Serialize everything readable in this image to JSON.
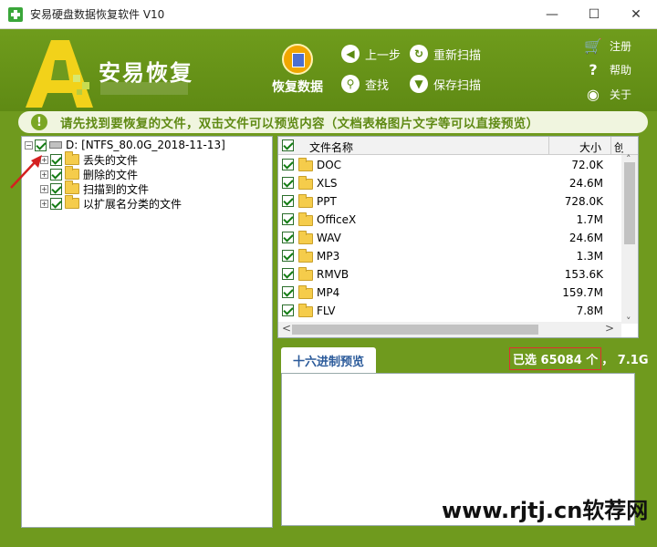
{
  "window": {
    "title": "安易硬盘数据恢复软件 V10",
    "minimize": "—",
    "maximize": "☐",
    "close": "✕"
  },
  "header": {
    "app_name": "安易恢复",
    "recover_label": "恢复数据",
    "toolbar": [
      {
        "icon": "arrow-left-icon",
        "glyph": "◀",
        "label": "上一步"
      },
      {
        "icon": "refresh-icon",
        "glyph": "↻",
        "label": "重新扫描"
      },
      {
        "icon": "search-icon",
        "glyph": "⚲",
        "label": "查找"
      },
      {
        "icon": "save-icon",
        "glyph": "▼",
        "label": "保存扫描"
      }
    ],
    "side": [
      {
        "icon": "cart-icon",
        "glyph": "🛒",
        "label": "注册"
      },
      {
        "icon": "help-icon",
        "glyph": "?",
        "label": "帮助"
      },
      {
        "icon": "about-icon",
        "glyph": "◉",
        "label": "关于"
      }
    ]
  },
  "hint": {
    "glyph": "!",
    "text": "请先找到要恢复的文件，双击文件可以预览内容（文档表格图片文字等可以直接预览）"
  },
  "tree": {
    "root": "D:  [NTFS_80.0G_2018-11-13]",
    "children": [
      "丢失的文件",
      "删除的文件",
      "扫描到的文件",
      "以扩展名分类的文件"
    ]
  },
  "list": {
    "col_name": "文件名称",
    "col_size": "大小",
    "col_extra": "创",
    "rows": [
      {
        "name": "DOC",
        "size": "72.0K"
      },
      {
        "name": "XLS",
        "size": "24.6M"
      },
      {
        "name": "PPT",
        "size": "728.0K"
      },
      {
        "name": "OfficeX",
        "size": "1.7M"
      },
      {
        "name": "WAV",
        "size": "24.6M"
      },
      {
        "name": "MP3",
        "size": "1.3M"
      },
      {
        "name": "RMVB",
        "size": "153.6K"
      },
      {
        "name": "MP4",
        "size": "159.7M"
      },
      {
        "name": "FLV",
        "size": "7.8M"
      }
    ],
    "scroll_left": "<",
    "scroll_right": ">",
    "scroll_up": "˄",
    "scroll_down": "˅"
  },
  "preview": {
    "tab": "十六进制预览",
    "selected_count": "已选 65084 个",
    "selected_size": "，  7.1G"
  },
  "watermark": "www.rjtj.cn软荐网",
  "colors": {
    "brand_green": "#6f9a1e",
    "hint_text": "#5f8a14",
    "highlight_red": "#e03030"
  }
}
